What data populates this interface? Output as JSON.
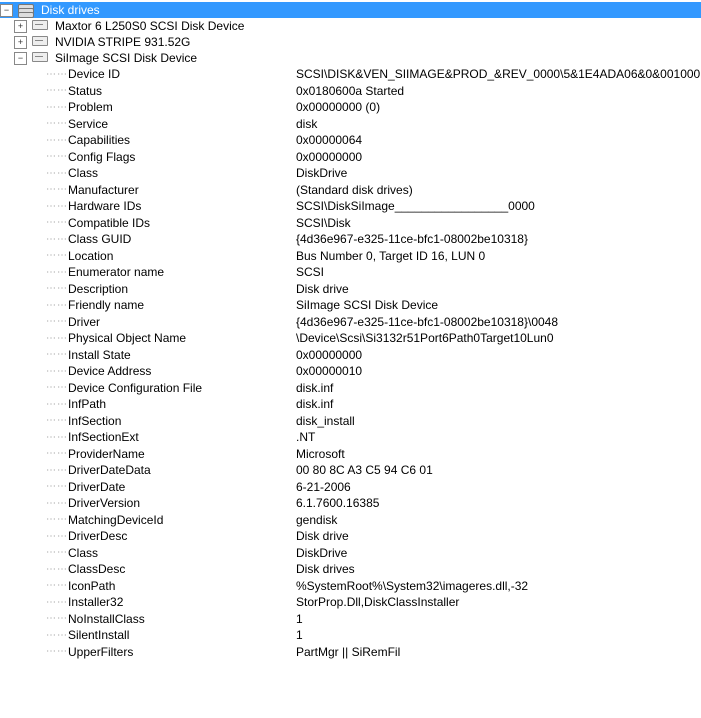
{
  "root": {
    "label": "Disk drives",
    "children": [
      {
        "label": "Maxtor 6 L250S0 SCSI Disk Device",
        "expandable": true
      },
      {
        "label": "NVIDIA  STRIPE   931.52G",
        "expandable": true
      },
      {
        "label": "SiImage  SCSI Disk Device",
        "expandable": true,
        "expanded": true
      }
    ]
  },
  "properties": [
    {
      "key": "Device ID",
      "value": "SCSI\\DISK&VEN_SIIMAGE&PROD_&REV_0000\\5&1E4ADA06&0&001000"
    },
    {
      "key": "Status",
      "value": "0x0180600a Started"
    },
    {
      "key": "Problem",
      "value": "0x00000000 (0)"
    },
    {
      "key": "Service",
      "value": "disk"
    },
    {
      "key": "Capabilities",
      "value": "0x00000064"
    },
    {
      "key": "Config Flags",
      "value": "0x00000000"
    },
    {
      "key": "Class",
      "value": "DiskDrive"
    },
    {
      "key": "Manufacturer",
      "value": "(Standard disk drives)"
    },
    {
      "key": "Hardware IDs",
      "value": "SCSI\\DiskSiImage_________________0000"
    },
    {
      "key": "Compatible IDs",
      "value": "SCSI\\Disk"
    },
    {
      "key": "Class GUID",
      "value": "{4d36e967-e325-11ce-bfc1-08002be10318}"
    },
    {
      "key": "Location",
      "value": "Bus Number 0, Target ID 16, LUN 0"
    },
    {
      "key": "Enumerator name",
      "value": "SCSI"
    },
    {
      "key": "Description",
      "value": "Disk drive"
    },
    {
      "key": "Friendly name",
      "value": "SiImage  SCSI Disk Device"
    },
    {
      "key": "Driver",
      "value": "{4d36e967-e325-11ce-bfc1-08002be10318}\\0048"
    },
    {
      "key": "Physical Object Name",
      "value": "\\Device\\Scsi\\Si3132r51Port6Path0Target10Lun0"
    },
    {
      "key": "Install State",
      "value": "0x00000000"
    },
    {
      "key": "Device Address",
      "value": "0x00000010"
    },
    {
      "key": "Device Configuration File",
      "value": "disk.inf"
    },
    {
      "key": "InfPath",
      "value": "disk.inf"
    },
    {
      "key": "InfSection",
      "value": "disk_install"
    },
    {
      "key": "InfSectionExt",
      "value": ".NT"
    },
    {
      "key": "ProviderName",
      "value": "Microsoft"
    },
    {
      "key": "DriverDateData",
      "value": "00 80 8C A3 C5 94 C6 01"
    },
    {
      "key": "DriverDate",
      "value": "6-21-2006"
    },
    {
      "key": "DriverVersion",
      "value": "6.1.7600.16385"
    },
    {
      "key": "MatchingDeviceId",
      "value": "gendisk"
    },
    {
      "key": "DriverDesc",
      "value": "Disk drive"
    },
    {
      "key": "Class",
      "value": "DiskDrive"
    },
    {
      "key": "ClassDesc",
      "value": "Disk drives"
    },
    {
      "key": "IconPath",
      "value": "%SystemRoot%\\System32\\imageres.dll,-32"
    },
    {
      "key": "Installer32",
      "value": "StorProp.Dll,DiskClassInstaller"
    },
    {
      "key": "NoInstallClass",
      "value": "1"
    },
    {
      "key": "SilentInstall",
      "value": "1"
    },
    {
      "key": "UpperFilters",
      "value": "PartMgr || SiRemFil"
    }
  ]
}
